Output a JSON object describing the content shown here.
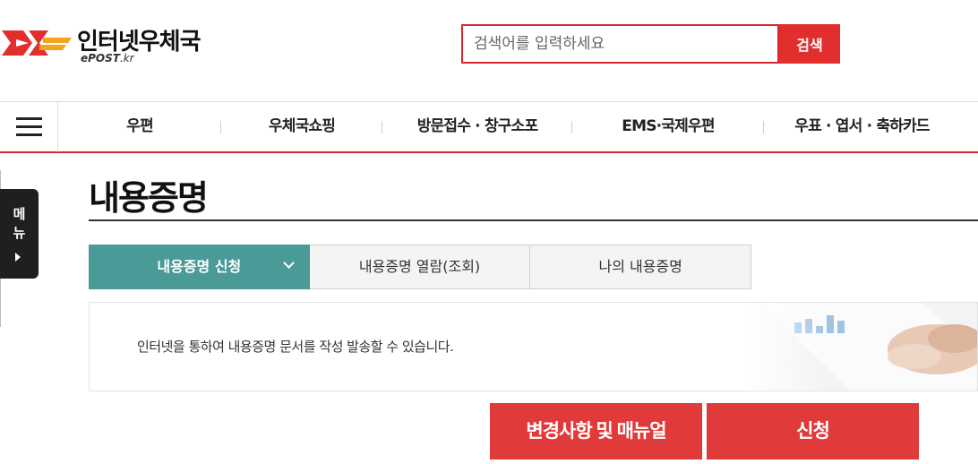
{
  "header": {
    "logo_title": "인터넷우체국",
    "logo_sub_main": "ePOST",
    "logo_sub_kr": ".kr",
    "search_placeholder": "검색어를 입력하세요",
    "search_button": "검색"
  },
  "nav": {
    "menu_icon": "hamburger-icon",
    "items": [
      {
        "label": "우편"
      },
      {
        "label": "우체국쇼핑"
      },
      {
        "label": "방문접수 · 창구소포"
      },
      {
        "label": "EMS·국제우편"
      },
      {
        "label": "우표 · 엽서 · 축하카드"
      }
    ]
  },
  "side_menu": {
    "label_1": "메",
    "label_2": "뉴"
  },
  "page": {
    "title": "내용증명",
    "tabs": [
      {
        "label": "내용증명 신청",
        "active": true
      },
      {
        "label": "내용증명 열람(조회)",
        "active": false
      },
      {
        "label": "나의 내용증명",
        "active": false
      }
    ],
    "info_text": "인터넷을 통하여 내용증명 문서를 작성 발송할 수 있습니다.",
    "buttons": {
      "manual": "변경사항 및 매뉴얼",
      "apply": "신청"
    }
  },
  "colors": {
    "brand_red": "#e03a3a",
    "tab_active": "#4a9a97"
  }
}
